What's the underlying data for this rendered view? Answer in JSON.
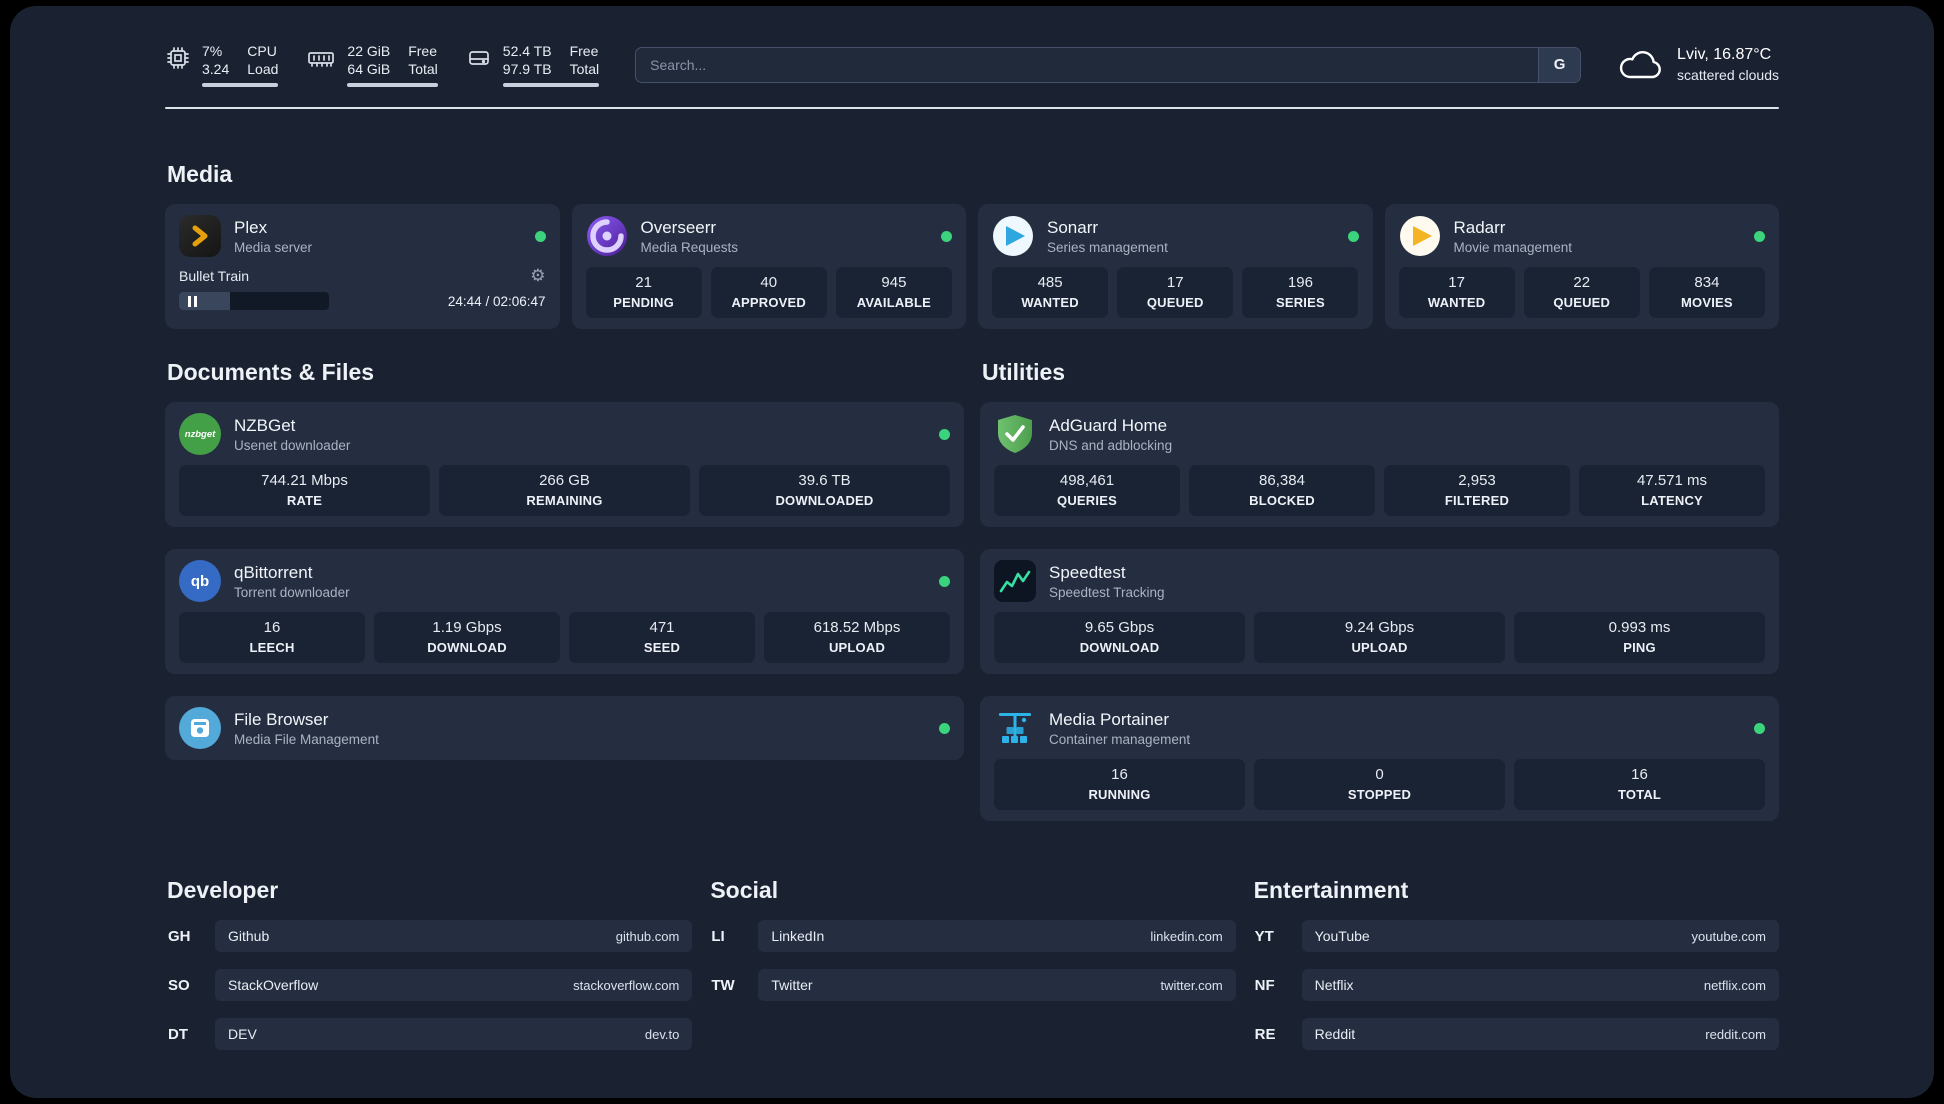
{
  "colors": {
    "status_online": "#3bd37c",
    "panel_bg": "#1a2231",
    "card_bg": "#242e40",
    "plex_gold": "#e5a00d"
  },
  "header": {
    "metrics": [
      {
        "name": "cpu",
        "line1": "7%",
        "line2": "3.24",
        "label1": "CPU",
        "label2": "Load"
      },
      {
        "name": "ram",
        "line1": "22 GiB",
        "line2": "64 GiB",
        "label1": "Free",
        "label2": "Total"
      },
      {
        "name": "disk",
        "line1": "52.4 TB",
        "line2": "97.9 TB",
        "label1": "Free",
        "label2": "Total"
      }
    ],
    "search": {
      "placeholder": "Search...",
      "button": "G"
    },
    "weather": {
      "location": "Lviv, 16.87°C",
      "condition": "scattered clouds"
    }
  },
  "media": {
    "title": "Media",
    "plex": {
      "name": "Plex",
      "subtitle": "Media server",
      "player": {
        "track": "Bullet Train",
        "time": "24:44 / 02:06:47"
      }
    },
    "overseerr": {
      "name": "Overseerr",
      "subtitle": "Media Requests",
      "stats": [
        {
          "value": "21",
          "label": "PENDING"
        },
        {
          "value": "40",
          "label": "APPROVED"
        },
        {
          "value": "945",
          "label": "AVAILABLE"
        }
      ]
    },
    "sonarr": {
      "name": "Sonarr",
      "subtitle": "Series management",
      "stats": [
        {
          "value": "485",
          "label": "WANTED"
        },
        {
          "value": "17",
          "label": "QUEUED"
        },
        {
          "value": "196",
          "label": "SERIES"
        }
      ]
    },
    "radarr": {
      "name": "Radarr",
      "subtitle": "Movie management",
      "stats": [
        {
          "value": "17",
          "label": "WANTED"
        },
        {
          "value": "22",
          "label": "QUEUED"
        },
        {
          "value": "834",
          "label": "MOVIES"
        }
      ]
    }
  },
  "documents": {
    "title": "Documents & Files",
    "nzbget": {
      "name": "NZBGet",
      "subtitle": "Usenet downloader",
      "icon_text": "nzbget",
      "stats": [
        {
          "value": "744.21 Mbps",
          "label": "RATE"
        },
        {
          "value": "266 GB",
          "label": "REMAINING"
        },
        {
          "value": "39.6 TB",
          "label": "DOWNLOADED"
        }
      ]
    },
    "qbittorrent": {
      "name": "qBittorrent",
      "subtitle": "Torrent downloader",
      "icon_text": "qb",
      "stats": [
        {
          "value": "16",
          "label": "LEECH"
        },
        {
          "value": "1.19 Gbps",
          "label": "DOWNLOAD"
        },
        {
          "value": "471",
          "label": "SEED"
        },
        {
          "value": "618.52 Mbps",
          "label": "UPLOAD"
        }
      ]
    },
    "filebrowser": {
      "name": "File Browser",
      "subtitle": "Media File Management"
    }
  },
  "utilities": {
    "title": "Utilities",
    "adguard": {
      "name": "AdGuard Home",
      "subtitle": "DNS and adblocking",
      "stats": [
        {
          "value": "498,461",
          "label": "QUERIES"
        },
        {
          "value": "86,384",
          "label": "BLOCKED"
        },
        {
          "value": "2,953",
          "label": "FILTERED"
        },
        {
          "value": "47.571 ms",
          "label": "LATENCY"
        }
      ]
    },
    "speedtest": {
      "name": "Speedtest",
      "subtitle": "Speedtest Tracking",
      "stats": [
        {
          "value": "9.65 Gbps",
          "label": "DOWNLOAD"
        },
        {
          "value": "9.24 Gbps",
          "label": "UPLOAD"
        },
        {
          "value": "0.993 ms",
          "label": "PING"
        }
      ]
    },
    "portainer": {
      "name": "Media Portainer",
      "subtitle": "Container management",
      "stats": [
        {
          "value": "16",
          "label": "RUNNING"
        },
        {
          "value": "0",
          "label": "STOPPED"
        },
        {
          "value": "16",
          "label": "TOTAL"
        }
      ]
    }
  },
  "bookmarks": {
    "developer": {
      "title": "Developer",
      "items": [
        {
          "abbr": "GH",
          "name": "Github",
          "url": "github.com"
        },
        {
          "abbr": "SO",
          "name": "StackOverflow",
          "url": "stackoverflow.com"
        },
        {
          "abbr": "DT",
          "name": "DEV",
          "url": "dev.to"
        }
      ]
    },
    "social": {
      "title": "Social",
      "items": [
        {
          "abbr": "LI",
          "name": "LinkedIn",
          "url": "linkedin.com"
        },
        {
          "abbr": "TW",
          "name": "Twitter",
          "url": "twitter.com"
        }
      ]
    },
    "entertainment": {
      "title": "Entertainment",
      "items": [
        {
          "abbr": "YT",
          "name": "YouTube",
          "url": "youtube.com"
        },
        {
          "abbr": "NF",
          "name": "Netflix",
          "url": "netflix.com"
        },
        {
          "abbr": "RE",
          "name": "Reddit",
          "url": "reddit.com"
        }
      ]
    }
  }
}
